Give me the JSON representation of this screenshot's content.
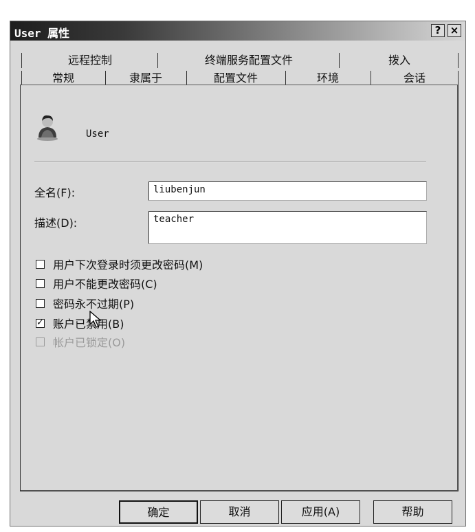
{
  "window": {
    "title": "User 属性",
    "help": "?",
    "close": "×"
  },
  "tabs_top": [
    "远程控制",
    "终端服务配置文件",
    "拨入"
  ],
  "tabs_bottom": [
    "常规",
    "隶属于",
    "配置文件",
    "环境",
    "会话"
  ],
  "general": {
    "username": "User",
    "fullname_label": "全名(F):",
    "fullname_value": "liubenjun",
    "description_label": "描述(D):",
    "description_value": "teacher",
    "checkboxes": [
      {
        "label": "用户下次登录时须更改密码(M)",
        "checked": false,
        "enabled": true
      },
      {
        "label": "用户不能更改密码(C)",
        "checked": false,
        "enabled": true
      },
      {
        "label": "密码永不过期(P)",
        "checked": false,
        "enabled": true
      },
      {
        "label": "账户已禁用(B)",
        "checked": true,
        "enabled": true
      },
      {
        "label": "帐户已锁定(O)",
        "checked": false,
        "enabled": false
      }
    ]
  },
  "buttons": {
    "ok": "确定",
    "cancel": "取消",
    "apply": "应用(A)",
    "help": "帮助"
  }
}
